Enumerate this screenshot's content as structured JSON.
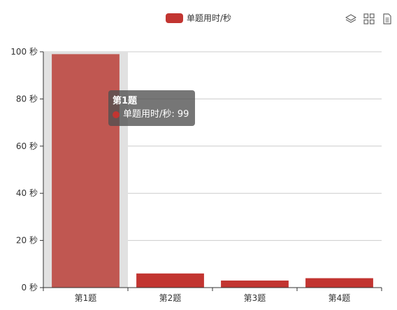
{
  "legend": {
    "label": "单题用时/秒",
    "color": "#c23531"
  },
  "toolbox": {
    "icons": [
      "stack-layers-icon",
      "data-grid-icon",
      "data-view-document-icon"
    ]
  },
  "tooltip": {
    "title": "第1题",
    "series": "单题用时/秒",
    "value": "99",
    "text": "单题用时/秒: 99"
  },
  "chart_data": {
    "type": "bar",
    "categories": [
      "第1题",
      "第2题",
      "第3题",
      "第4题"
    ],
    "series": [
      {
        "name": "单题用时/秒",
        "values": [
          99,
          6,
          3,
          4
        ]
      }
    ],
    "ylim": [
      0,
      100
    ],
    "yticks": [
      0,
      20,
      40,
      60,
      80,
      100
    ],
    "ytick_labels": [
      "0 秒",
      "20 秒",
      "40 秒",
      "60 秒",
      "80 秒",
      "100 秒"
    ],
    "grid": true,
    "legend_position": "top-center",
    "highlighted_category": "第1题",
    "colors": {
      "bar": "#c23531",
      "bar_hover": "#c05751",
      "axis_pointer_shadow": "#e1e1e1",
      "grid": "#cccccc",
      "axis": "#333333"
    }
  }
}
